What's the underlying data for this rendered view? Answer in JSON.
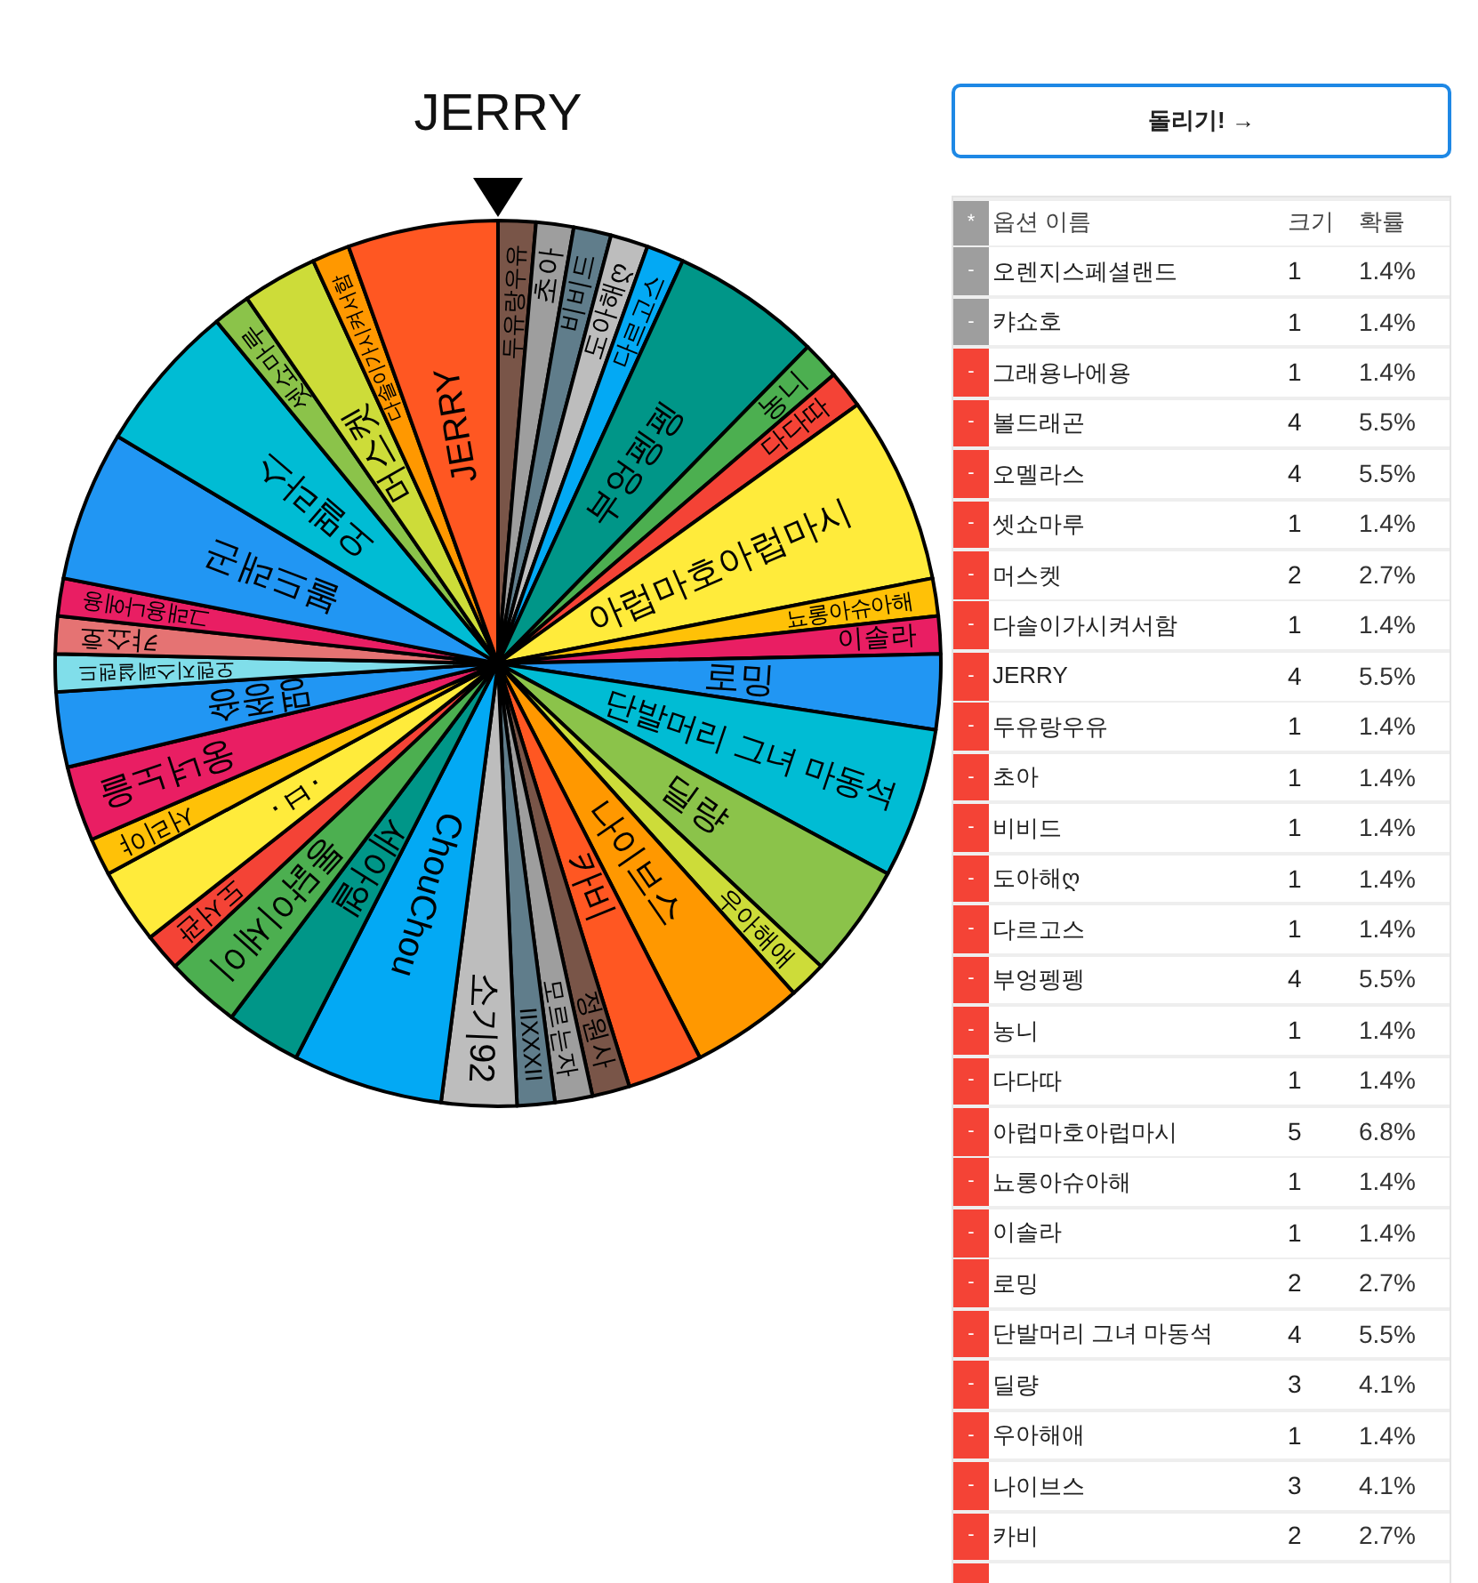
{
  "title": "JERRY",
  "wheel": {
    "labels": [
      "두유랑우유",
      "초아",
      "비비드",
      "도아해ღ",
      "다르고스",
      "부엉펭펭",
      "농니",
      "다다따",
      "아럽마호아럽마시",
      "뇨롱아슈아해",
      "이솔라",
      "로밍",
      "단발머리 그녀 마동석",
      "딜량",
      "우아해애",
      "나이브스",
      "카비",
      "정원사",
      "모르는자",
      "IIXXXII",
      "소기92",
      "ChouChou",
      "세아엘",
      "통닭이세이",
      "도서관",
      "·ㅂ·",
      "서리야",
      "웅녀노을",
      "명종숑",
      "오렌지스페셜랜드",
      "캬쇼호",
      "그래용나에용",
      "볼드래곤",
      "오멜라스",
      "셋쇼마루",
      "머스켓",
      "다솔이가시켜서함",
      "JERRY"
    ]
  },
  "spin_button": {
    "label": "돌리기! →"
  },
  "table": {
    "header": {
      "button": "*",
      "columns": [
        "옵션 이름",
        "크기",
        "확률"
      ]
    },
    "rows": [
      {
        "button": "-",
        "name": "오렌지스페셜랜드",
        "size": "1",
        "probability": "1.4%",
        "disabled": true
      },
      {
        "button": "-",
        "name": "캬쇼호",
        "size": "1",
        "probability": "1.4%",
        "disabled": true
      },
      {
        "button": "-",
        "name": "그래용나에용",
        "size": "1",
        "probability": "1.4%",
        "disabled": false
      },
      {
        "button": "-",
        "name": "볼드래곤",
        "size": "4",
        "probability": "5.5%",
        "disabled": false
      },
      {
        "button": "-",
        "name": "오멜라스",
        "size": "4",
        "probability": "5.5%",
        "disabled": false
      },
      {
        "button": "-",
        "name": "셋쇼마루",
        "size": "1",
        "probability": "1.4%",
        "disabled": false
      },
      {
        "button": "-",
        "name": "머스켓",
        "size": "2",
        "probability": "2.7%",
        "disabled": false
      },
      {
        "button": "-",
        "name": "다솔이가시켜서함",
        "size": "1",
        "probability": "1.4%",
        "disabled": false
      },
      {
        "button": "-",
        "name": "JERRY",
        "size": "4",
        "probability": "5.5%",
        "disabled": false
      },
      {
        "button": "-",
        "name": "두유랑우유",
        "size": "1",
        "probability": "1.4%",
        "disabled": false
      },
      {
        "button": "-",
        "name": "초아",
        "size": "1",
        "probability": "1.4%",
        "disabled": false
      },
      {
        "button": "-",
        "name": "비비드",
        "size": "1",
        "probability": "1.4%",
        "disabled": false
      },
      {
        "button": "-",
        "name": "도아해ღ",
        "size": "1",
        "probability": "1.4%",
        "disabled": false
      },
      {
        "button": "-",
        "name": "다르고스",
        "size": "1",
        "probability": "1.4%",
        "disabled": false
      },
      {
        "button": "-",
        "name": "부엉펭펭",
        "size": "4",
        "probability": "5.5%",
        "disabled": false
      },
      {
        "button": "-",
        "name": "농니",
        "size": "1",
        "probability": "1.4%",
        "disabled": false
      },
      {
        "button": "-",
        "name": "다다따",
        "size": "1",
        "probability": "1.4%",
        "disabled": false
      },
      {
        "button": "-",
        "name": "아럽마호아럽마시",
        "size": "5",
        "probability": "6.8%",
        "disabled": false
      },
      {
        "button": "-",
        "name": "뇨롱아슈아해",
        "size": "1",
        "probability": "1.4%",
        "disabled": false
      },
      {
        "button": "-",
        "name": "이솔라",
        "size": "1",
        "probability": "1.4%",
        "disabled": false
      },
      {
        "button": "-",
        "name": "로밍",
        "size": "2",
        "probability": "2.7%",
        "disabled": false
      },
      {
        "button": "-",
        "name": "단발머리 그녀 마동석",
        "size": "4",
        "probability": "5.5%",
        "disabled": false
      },
      {
        "button": "-",
        "name": "딜량",
        "size": "3",
        "probability": "4.1%",
        "disabled": false
      },
      {
        "button": "-",
        "name": "우아해애",
        "size": "1",
        "probability": "1.4%",
        "disabled": false
      },
      {
        "button": "-",
        "name": "나이브스",
        "size": "3",
        "probability": "4.1%",
        "disabled": false
      },
      {
        "button": "-",
        "name": "카비",
        "size": "2",
        "probability": "2.7%",
        "disabled": false
      },
      {
        "disabled": false
      }
    ]
  }
}
